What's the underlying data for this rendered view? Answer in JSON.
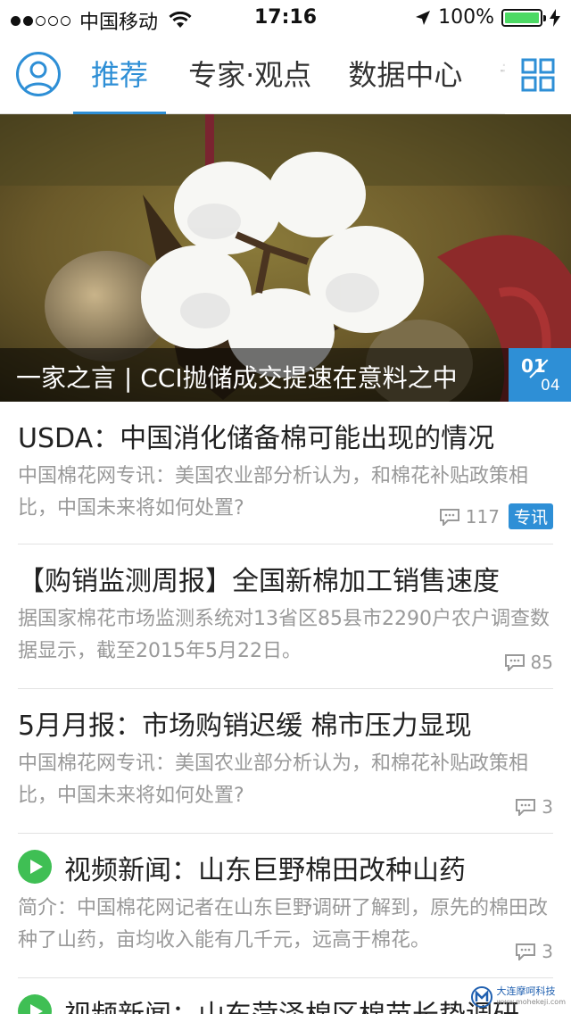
{
  "status_bar": {
    "carrier": "中国移动",
    "time": "17:16",
    "battery_text": "100%",
    "battery_level": 1.0,
    "signal_strength": 2,
    "signal_max": 5
  },
  "nav": {
    "tabs": [
      {
        "label": "推荐",
        "active": true
      },
      {
        "label": "专家·观点",
        "active": false
      },
      {
        "label": "数据中心",
        "active": false
      },
      {
        "label": "专",
        "active": false
      }
    ],
    "icons": {
      "avatar": "user-avatar-icon",
      "grid": "grid-menu-icon"
    }
  },
  "banner": {
    "caption": "一家之言 | CCI抛储成交提速在意料之中",
    "page_current": "01",
    "page_total": "04"
  },
  "news": [
    {
      "title": "USDA：中国消化储备棉可能出现的情况",
      "summary": "中国棉花网专讯：美国农业部分析认为，和棉花补贴政策相比，中国未来将如何处置?",
      "comments": "117",
      "tag": "专讯",
      "video": false
    },
    {
      "title": "【购销监测周报】全国新棉加工销售速度",
      "summary": "据国家棉花市场监测系统对13省区85县市2290户农户调查数据显示，截至2015年5月22日。",
      "comments": "85",
      "tag": "",
      "video": false
    },
    {
      "title": "5月月报：市场购销迟缓 棉市压力显现",
      "summary": "中国棉花网专讯：美国农业部分析认为，和棉花补贴政策相比，中国未来将如何处置?",
      "comments": "3",
      "tag": "",
      "video": false
    },
    {
      "title": "视频新闻：山东巨野棉田改种山药",
      "summary": "简介：中国棉花网记者在山东巨野调研了解到，原先的棉田改种了山药，亩均收入能有几千元，远高于棉花。",
      "comments": "3",
      "tag": "",
      "video": true
    },
    {
      "title": "视频新闻：山东菏泽棉区棉苗长势调研",
      "summary": "",
      "comments": "",
      "tag": "",
      "video": true
    }
  ],
  "watermark": {
    "name": "大连摩呵科技",
    "site": "www.mohekeji.com"
  },
  "colors": {
    "accent": "#2e8fd6",
    "play_green": "#3fbf54",
    "battery_green": "#4cd964"
  }
}
